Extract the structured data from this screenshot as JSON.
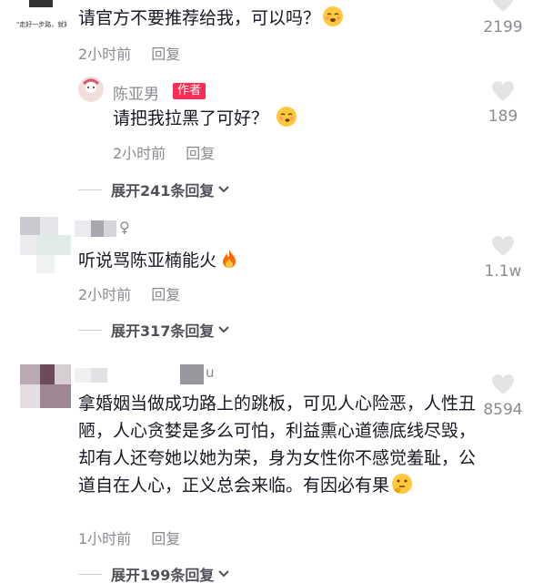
{
  "comments": [
    {
      "text": "请官方不要推荐给我，可以吗？",
      "time": "2小时前",
      "reply": "回复",
      "likes": "2199",
      "avatar_caption": "\"走好一步路，就好\" 与众面画",
      "sub_reply": {
        "author": "陈亚男",
        "badge": "作者",
        "text": "请把我拉黑了可好？",
        "time": "2小时前",
        "reply": "回复",
        "likes": "189"
      },
      "expand": "展开241条回复"
    },
    {
      "text": "听说骂陈亚楠能火",
      "time": "2小时前",
      "reply": "回复",
      "likes": "1.1w",
      "expand": "展开317条回复"
    },
    {
      "name_suffix": "u",
      "text": "拿婚姻当做成功路上的跳板，可见人心险恶，人性丑陋，人心贪婪是多么可怕，利益熏心道德底线尽毁，却有人还夸她以她为荣，身为女性你不感觉羞耻，公道自在人心，正义总会来临。有因必有果",
      "time": "1小时前",
      "reply": "回复",
      "likes": "8594",
      "expand": "展开199条回复"
    }
  ]
}
